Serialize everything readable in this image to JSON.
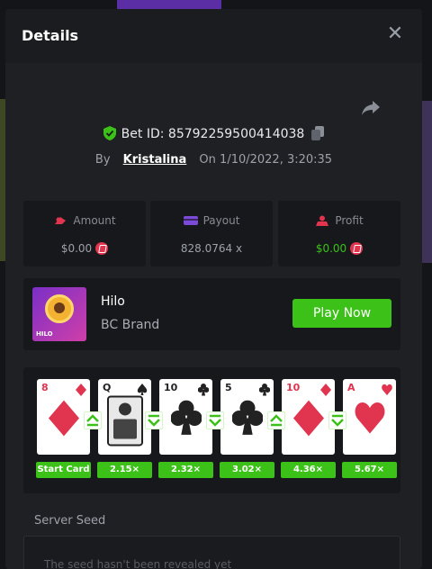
{
  "modal": {
    "title": "Details",
    "bet_id": "Bet ID: 85792259500414038",
    "by_label": "By",
    "username": "Kristalina",
    "on_label": "On",
    "datetime": "1/10/2022, 3:20:35"
  },
  "stats": {
    "amount_label": "Amount",
    "amount_value": "$0.00",
    "payout_label": "Payout",
    "payout_value": "828.0764 x",
    "profit_label": "Profit",
    "profit_value": "$0.00"
  },
  "game": {
    "thumb_text": "HILO",
    "name": "Hilo",
    "brand": "BC Brand",
    "play_label": "Play Now"
  },
  "cards": [
    {
      "rank": "8",
      "suit": "diamond",
      "color": "#e0344f",
      "label": "Start Card"
    },
    {
      "rank": "Q",
      "suit": "spade",
      "color": "#222222",
      "label": "2.15×"
    },
    {
      "rank": "10",
      "suit": "club",
      "color": "#222222",
      "label": "2.32×"
    },
    {
      "rank": "5",
      "suit": "club",
      "color": "#222222",
      "label": "3.02×"
    },
    {
      "rank": "10",
      "suit": "diamond",
      "color": "#e0344f",
      "label": "4.36×"
    },
    {
      "rank": "A",
      "suit": "heart",
      "color": "#e0344f",
      "label": "5.67×"
    }
  ],
  "arrows": [
    "up",
    "down",
    "down",
    "up",
    "down"
  ],
  "server_seed": {
    "label": "Server Seed",
    "text": "The seed hasn't been revealed yet"
  },
  "colors": {
    "accent": "#3bc117",
    "danger": "#e0344f",
    "bg": "#1e2024",
    "panel": "#17181b"
  }
}
